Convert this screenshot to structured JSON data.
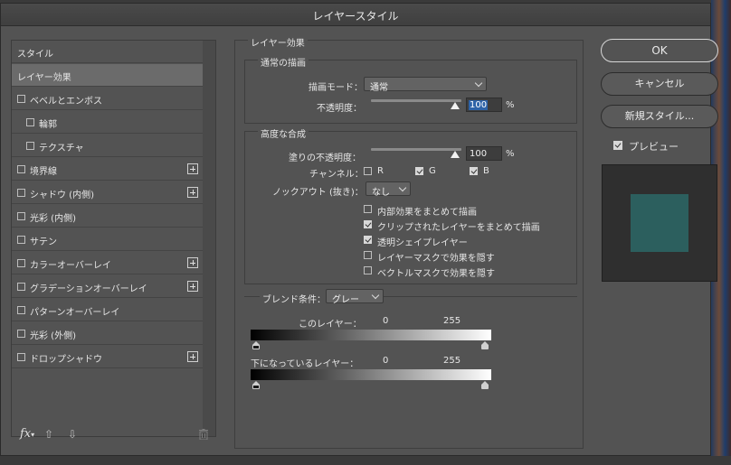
{
  "dialog": {
    "title": "レイヤースタイル"
  },
  "style_list": {
    "items": [
      {
        "label": "スタイル",
        "checkbox": false,
        "plus": false,
        "indent": 0,
        "active": false
      },
      {
        "label": "レイヤー効果",
        "checkbox": false,
        "plus": false,
        "indent": 0,
        "active": true
      },
      {
        "label": "ベベルとエンボス",
        "checkbox": true,
        "plus": false,
        "indent": 0,
        "active": false
      },
      {
        "label": "輪郭",
        "checkbox": true,
        "plus": false,
        "indent": 1,
        "active": false
      },
      {
        "label": "テクスチャ",
        "checkbox": true,
        "plus": false,
        "indent": 1,
        "active": false
      },
      {
        "label": "境界線",
        "checkbox": true,
        "plus": true,
        "indent": 0,
        "active": false
      },
      {
        "label": "シャドウ (内側)",
        "checkbox": true,
        "plus": true,
        "indent": 0,
        "active": false
      },
      {
        "label": "光彩 (内側)",
        "checkbox": true,
        "plus": false,
        "indent": 0,
        "active": false
      },
      {
        "label": "サテン",
        "checkbox": true,
        "plus": false,
        "indent": 0,
        "active": false
      },
      {
        "label": "カラーオーバーレイ",
        "checkbox": true,
        "plus": true,
        "indent": 0,
        "active": false
      },
      {
        "label": "グラデーションオーバーレイ",
        "checkbox": true,
        "plus": true,
        "indent": 0,
        "active": false
      },
      {
        "label": "パターンオーバーレイ",
        "checkbox": true,
        "plus": false,
        "indent": 0,
        "active": false
      },
      {
        "label": "光彩 (外側)",
        "checkbox": true,
        "plus": false,
        "indent": 0,
        "active": false
      },
      {
        "label": "ドロップシャドウ",
        "checkbox": true,
        "plus": true,
        "indent": 0,
        "active": false
      }
    ],
    "footer": {
      "fx": "fx",
      "up_icon": "arrow-up-icon",
      "down_icon": "arrow-down-icon",
      "trash_icon": "trash-icon"
    }
  },
  "layer_effects": {
    "title": "レイヤー効果",
    "normal_blend": {
      "title": "通常の描画",
      "blend_mode_label": "描画モード：",
      "blend_mode_value": "通常",
      "opacity_label": "不透明度：",
      "opacity_value": "100",
      "opacity_unit": "%"
    },
    "advanced_blend": {
      "title": "高度な合成",
      "fill_opacity_label": "塗りの不透明度：",
      "fill_opacity_value": "100",
      "fill_opacity_unit": "%",
      "channels_label": "チャンネル：",
      "channels": [
        {
          "label": "R",
          "checked": false
        },
        {
          "label": "G",
          "checked": true
        },
        {
          "label": "B",
          "checked": true
        }
      ],
      "knockout_label": "ノックアウト (抜き)：",
      "knockout_value": "なし",
      "options": [
        {
          "label": "内部効果をまとめて描画",
          "checked": false
        },
        {
          "label": "クリップされたレイヤーをまとめて描画",
          "checked": true
        },
        {
          "label": "透明シェイプレイヤー",
          "checked": true
        },
        {
          "label": "レイヤーマスクで効果を隠す",
          "checked": false
        },
        {
          "label": "ベクトルマスクで効果を隠す",
          "checked": false
        }
      ]
    },
    "blend_if": {
      "title": "ブレンド条件：",
      "value": "グレー",
      "this_layer_label": "このレイヤー：",
      "this_layer_min": "0",
      "this_layer_max": "255",
      "underlying_label": "下になっているレイヤー：",
      "underlying_min": "0",
      "underlying_max": "255"
    }
  },
  "buttons": {
    "ok": "OK",
    "cancel": "キャンセル",
    "new_style": "新規スタイル...",
    "preview_label": "プレビュー",
    "preview_checked": true
  },
  "colors": {
    "preview_swatch": "#2c5f5e",
    "dialog_bg": "#535353",
    "selection": "#2e63a8"
  }
}
